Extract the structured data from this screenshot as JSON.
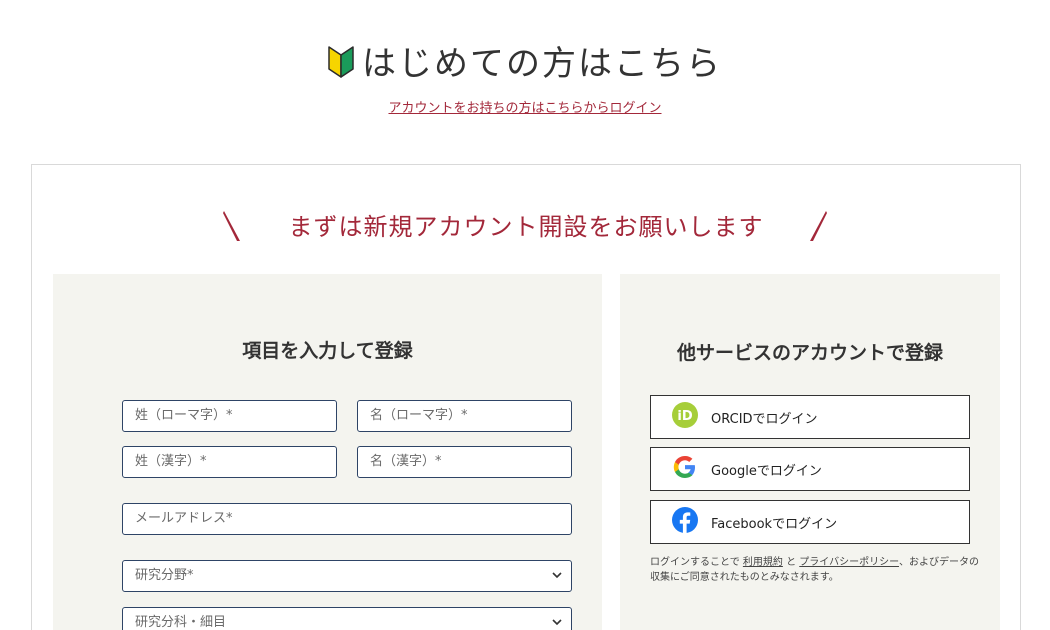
{
  "header": {
    "title": "はじめての方はこちら",
    "login_link": "アカウントをお持ちの方はこちらからログイン"
  },
  "card": {
    "heading": "まずは新規アカウント開設をお願いします"
  },
  "form": {
    "title": "項目を入力して登録",
    "fields": {
      "last_name_roman": "姓（ローマ字）*",
      "first_name_roman": "名（ローマ字）*",
      "last_name_kanji": "姓（漢字）*",
      "first_name_kanji": "名（漢字）*",
      "email": "メールアドレス*",
      "research_field": "研究分野*",
      "research_subfield": "研究分科・細目"
    }
  },
  "social": {
    "title": "他サービスのアカウントで登録",
    "buttons": {
      "orcid": "ORCIDでログイン",
      "google": "Googleでログイン",
      "facebook": "Facebookでログイン"
    },
    "note": {
      "prefix": "ログインすることで",
      "terms": "利用規約",
      "and": "と",
      "privacy": "プライバシーポリシー",
      "suffix": "、およびデータの収集にご同意されたものとみなされます。"
    }
  },
  "colors": {
    "accent": "#a3283a",
    "panel_bg": "#f4f4ef",
    "field_border": "#2e4466",
    "orcid": "#a6ce39",
    "facebook": "#1877f2"
  }
}
